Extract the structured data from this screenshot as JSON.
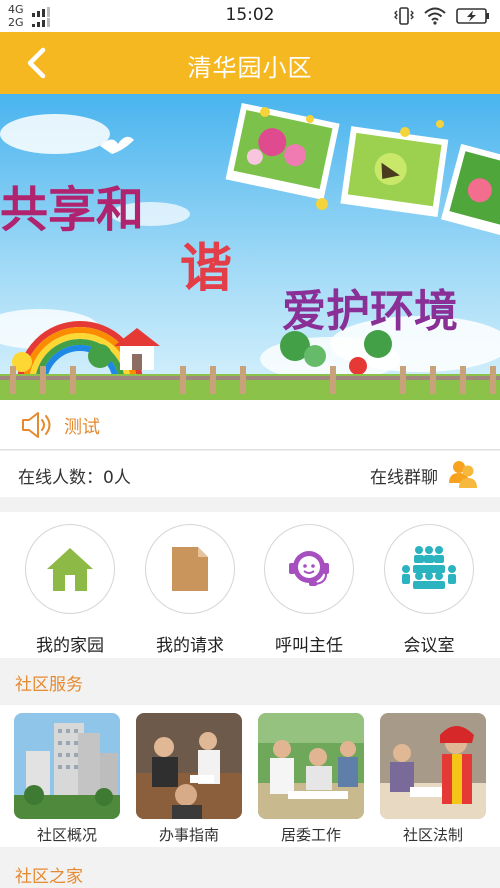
{
  "status_bar": {
    "network_top": "4G",
    "network_bottom": "2G",
    "time": "15:02",
    "icons": [
      "signal-bars-icon",
      "vibrate-icon",
      "wifi-icon",
      "battery-charging-icon"
    ]
  },
  "app_bar": {
    "title": "清华园小区",
    "back_icon": "chevron-left-icon",
    "background": "#f6b820"
  },
  "banner": {
    "text_line1": "共享和",
    "text_line2": "谐",
    "text_line3": "爱护环境"
  },
  "notice": {
    "icon": "speaker-icon",
    "text": "测试"
  },
  "online": {
    "count_text": "在线人数：0人",
    "chat_label": "在线群聊",
    "chat_icon": "group-chat-icon"
  },
  "features": [
    {
      "label": "我的家园",
      "icon": "house-icon",
      "color": "#8dba46"
    },
    {
      "label": "我的请求",
      "icon": "document-icon",
      "color": "#c9955c"
    },
    {
      "label": "呼叫主任",
      "icon": "headset-person-icon",
      "color": "#a64fbf"
    },
    {
      "label": "会议室",
      "icon": "meeting-room-icon",
      "color": "#2bb3c0"
    }
  ],
  "sections": {
    "services_title": "社区服务",
    "home_title": "社区之家"
  },
  "services": [
    {
      "label": "社区概况"
    },
    {
      "label": "办事指南"
    },
    {
      "label": "居委工作"
    },
    {
      "label": "社区法制"
    }
  ],
  "colors": {
    "accent": "#f6b820",
    "section_title": "#e58a2e"
  }
}
